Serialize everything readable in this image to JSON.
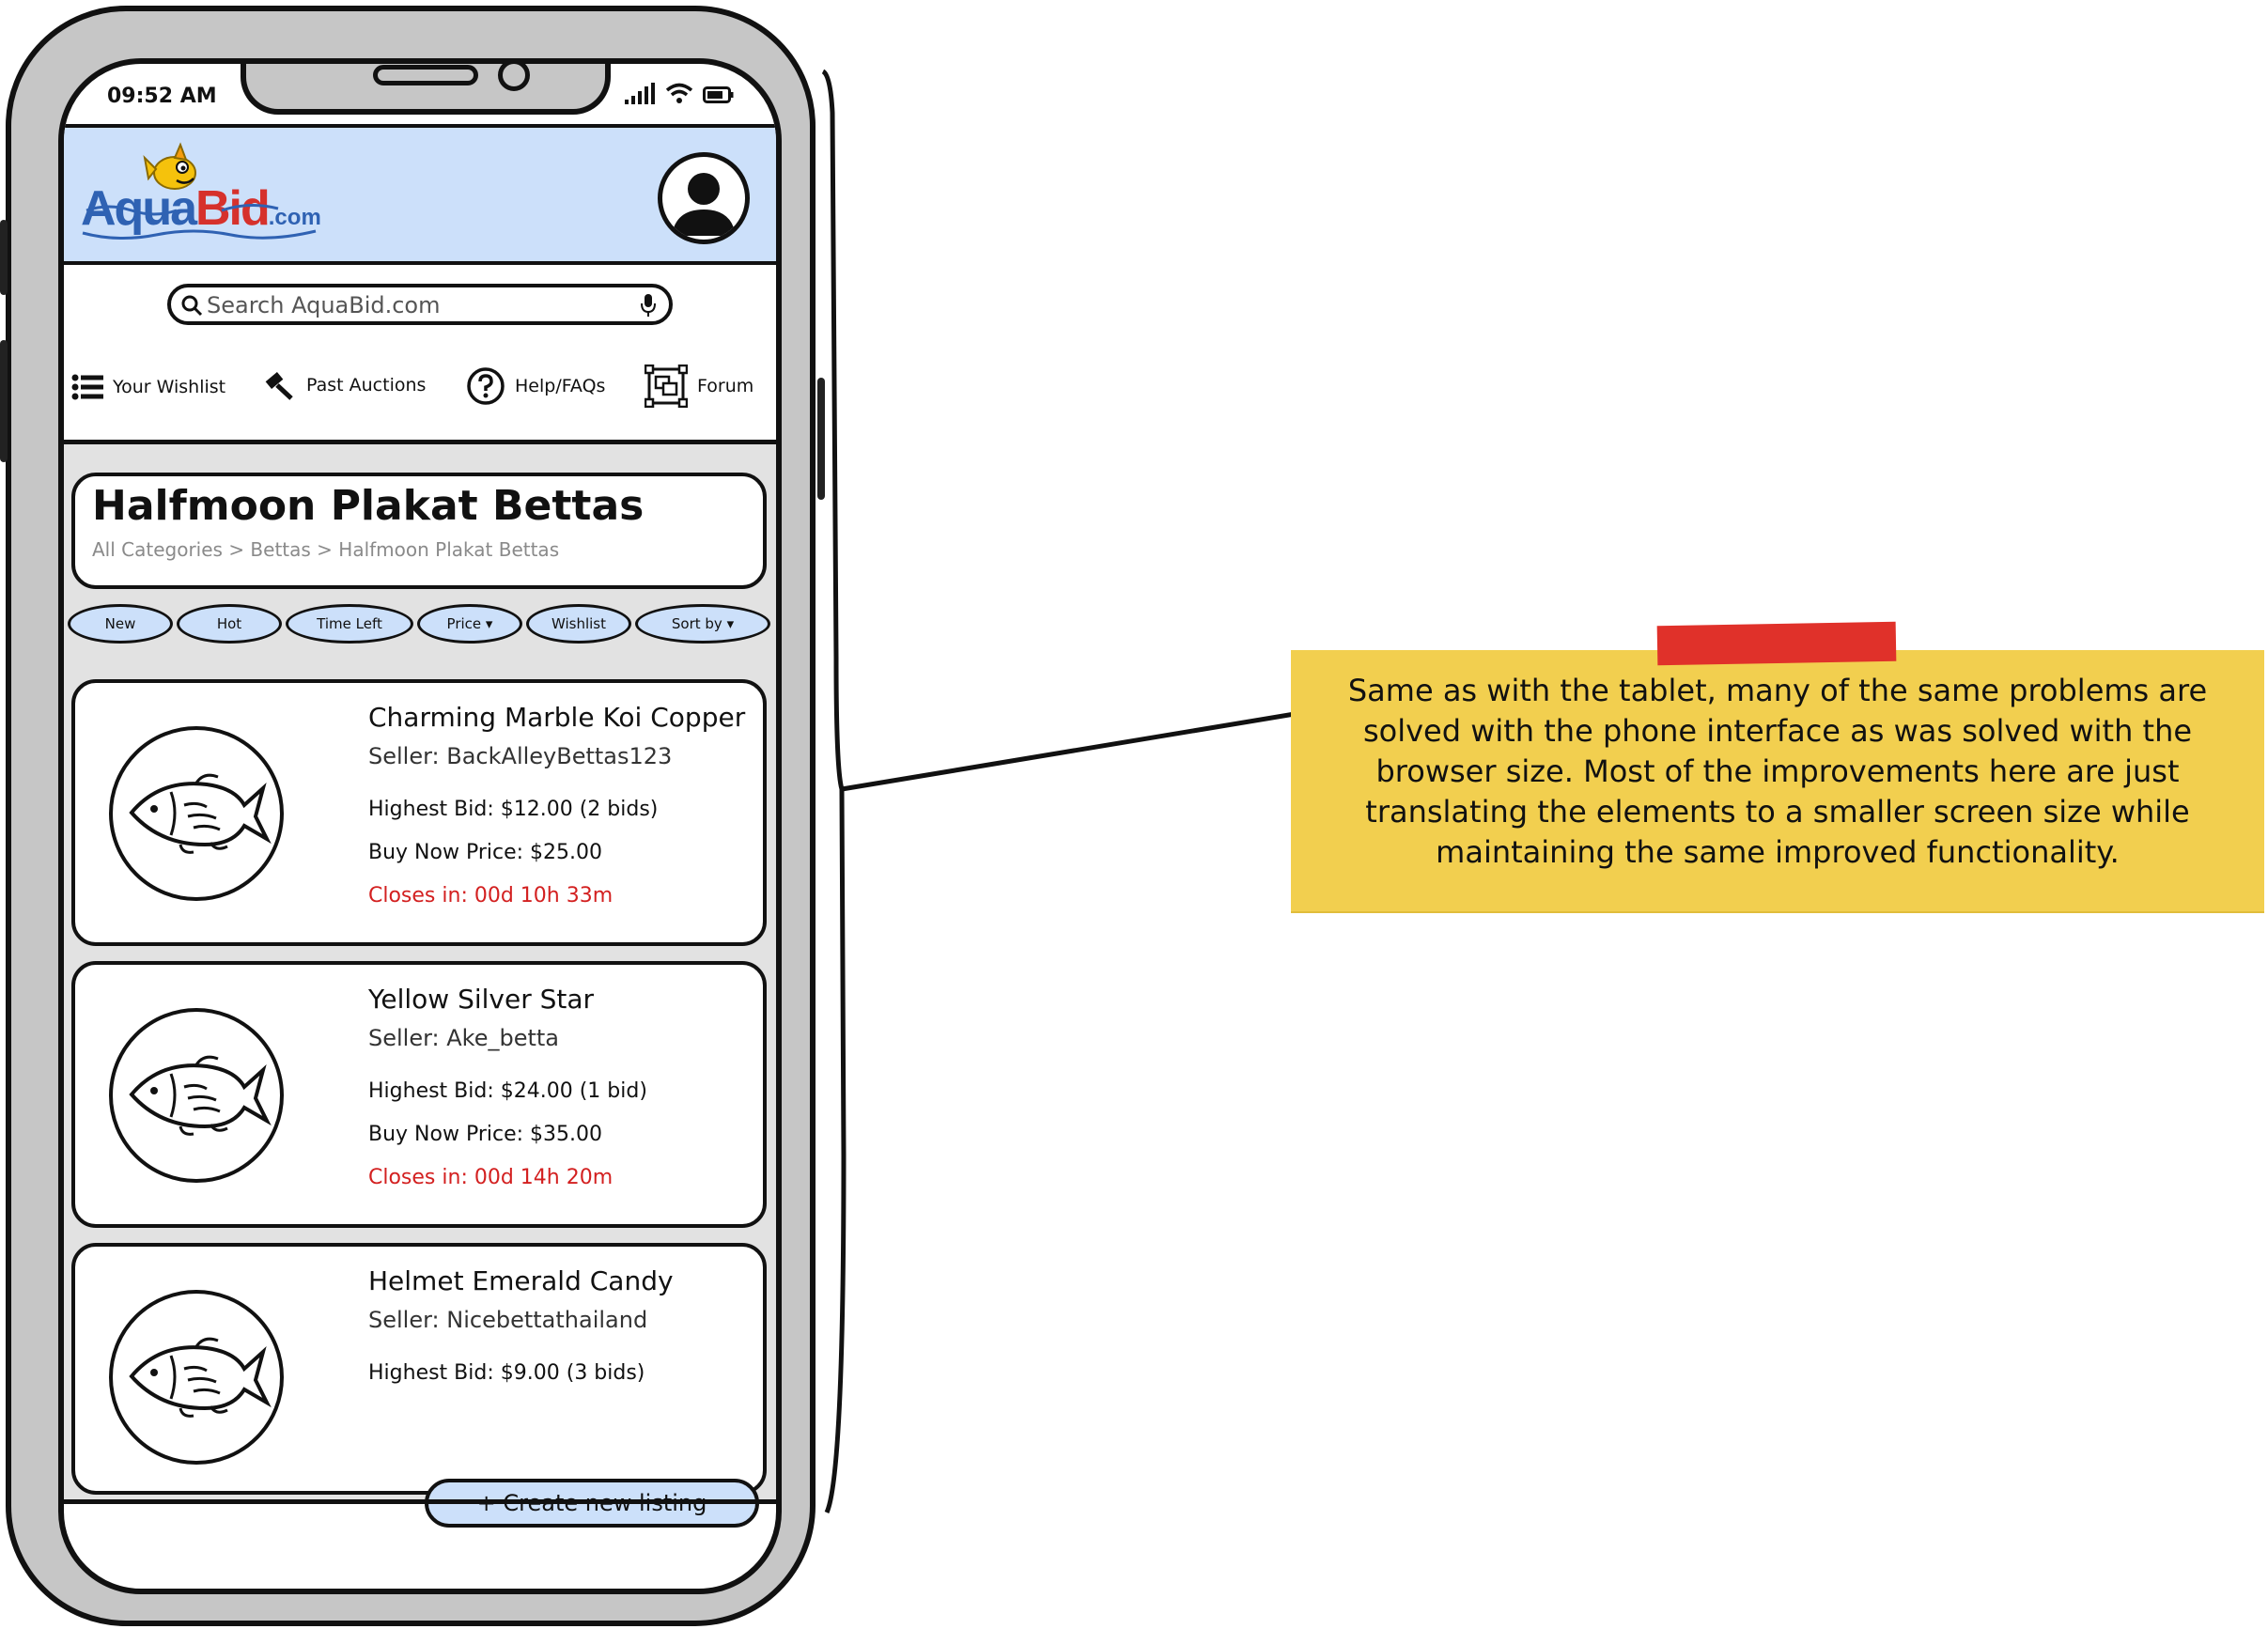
{
  "status_bar": {
    "time": "09:52 AM"
  },
  "header": {
    "logo": {
      "aqua": "Aqua",
      "bid": "Bid",
      "com": ".com"
    }
  },
  "search": {
    "placeholder": "Search AquaBid.com"
  },
  "nav": {
    "items": [
      {
        "label": "Your Wishlist",
        "icon": "list-icon"
      },
      {
        "label": "Past Auctions",
        "icon": "gavel-icon"
      },
      {
        "label": "Help/FAQs",
        "icon": "help-icon"
      },
      {
        "label": "Forum",
        "icon": "forum-icon"
      }
    ]
  },
  "page": {
    "title": "Halfmoon Plakat Bettas",
    "breadcrumb": "All Categories > Bettas > Halfmoon Plakat Bettas"
  },
  "filters": [
    {
      "label": "New"
    },
    {
      "label": "Hot"
    },
    {
      "label": "Time Left"
    },
    {
      "label": "Price ▾"
    },
    {
      "label": "Wishlist"
    },
    {
      "label": "Sort by ▾"
    }
  ],
  "listings": [
    {
      "title": "Charming Marble Koi Copper",
      "seller": "Seller: BackAlleyBettas123",
      "highest_bid": "Highest Bid: $12.00 (2 bids)",
      "buy_now": "Buy Now Price: $25.00",
      "closes_in": "Closes in: 00d 10h 33m"
    },
    {
      "title": "Yellow Silver Star",
      "seller": "Seller: Ake_betta",
      "highest_bid": "Highest Bid: $24.00 (1 bid)",
      "buy_now": "Buy Now Price: $35.00",
      "closes_in": "Closes in: 00d 14h 20m"
    },
    {
      "title": "Helmet Emerald Candy",
      "seller": "Seller: Nicebettathailand",
      "highest_bid": "Highest Bid: $9.00 (3 bids)"
    }
  ],
  "create_button": {
    "label": "+ Create new listing"
  },
  "annotation": {
    "text": "Same as with the tablet, many of the same problems are solved with the phone interface as was solved with the browser size. Most of the improvements here are just translating the elements to a smaller screen size while maintaining the same improved functionality."
  },
  "colors": {
    "header_bg": "#cce0fa",
    "chip_bg": "#cce0fa",
    "closes_text": "#d32020",
    "sticky_note": "#f2cf4f",
    "tape": "#e0312a",
    "logo_blue": "#2f62b3",
    "logo_red": "#d6312c"
  }
}
